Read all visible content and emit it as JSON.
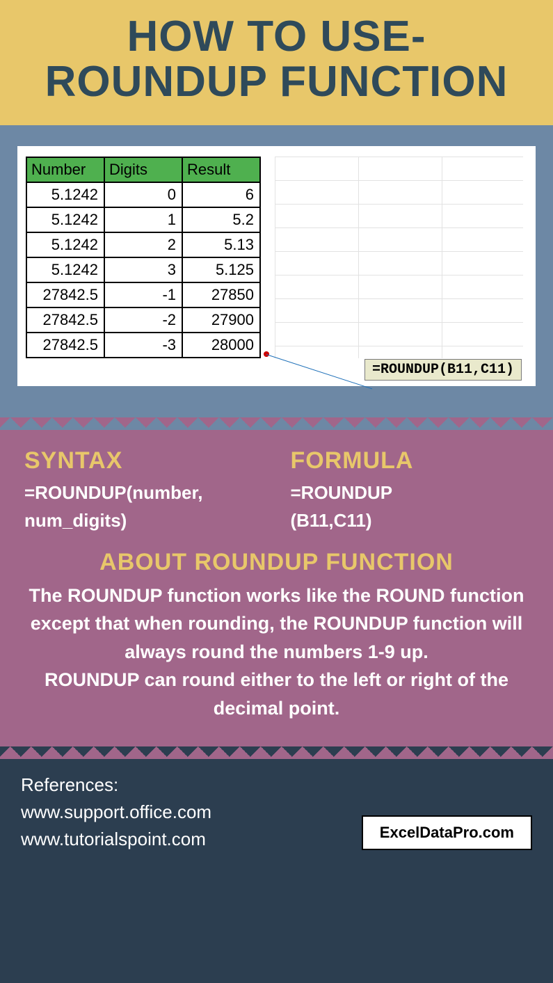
{
  "title_line1": "HOW TO USE-",
  "title_line2": "ROUNDUP FUNCTION",
  "table": {
    "headers": [
      "Number",
      "Digits",
      "Result"
    ],
    "rows": [
      [
        "5.1242",
        "0",
        "6"
      ],
      [
        "5.1242",
        "1",
        "5.2"
      ],
      [
        "5.1242",
        "2",
        "5.13"
      ],
      [
        "5.1242",
        "3",
        "5.125"
      ],
      [
        "27842.5",
        "-1",
        "27850"
      ],
      [
        "27842.5",
        "-2",
        "27900"
      ],
      [
        "27842.5",
        "-3",
        "28000"
      ]
    ]
  },
  "formula_tooltip": "=ROUNDUP(B11,C11)",
  "syntax_label": "SYNTAX",
  "syntax_code_l1": "=ROUNDUP(number,",
  "syntax_code_l2": "num_digits)",
  "formula_label": "FORMULA",
  "formula_code_l1": "=ROUNDUP",
  "formula_code_l2": "(B11,C11)",
  "about_label": "ABOUT ROUNDUP FUNCTION",
  "about_p1": "The ROUNDUP function works like the ROUND function except that when rounding, the ROUNDUP function will always round the numbers 1-9 up.",
  "about_p2": "ROUNDUP can round either to the left or right of the decimal point.",
  "references_label": "References:",
  "ref1": "www.support.office.com",
  "ref2": "www.tutorialspoint.com",
  "brand": "ExcelDataPro.com"
}
